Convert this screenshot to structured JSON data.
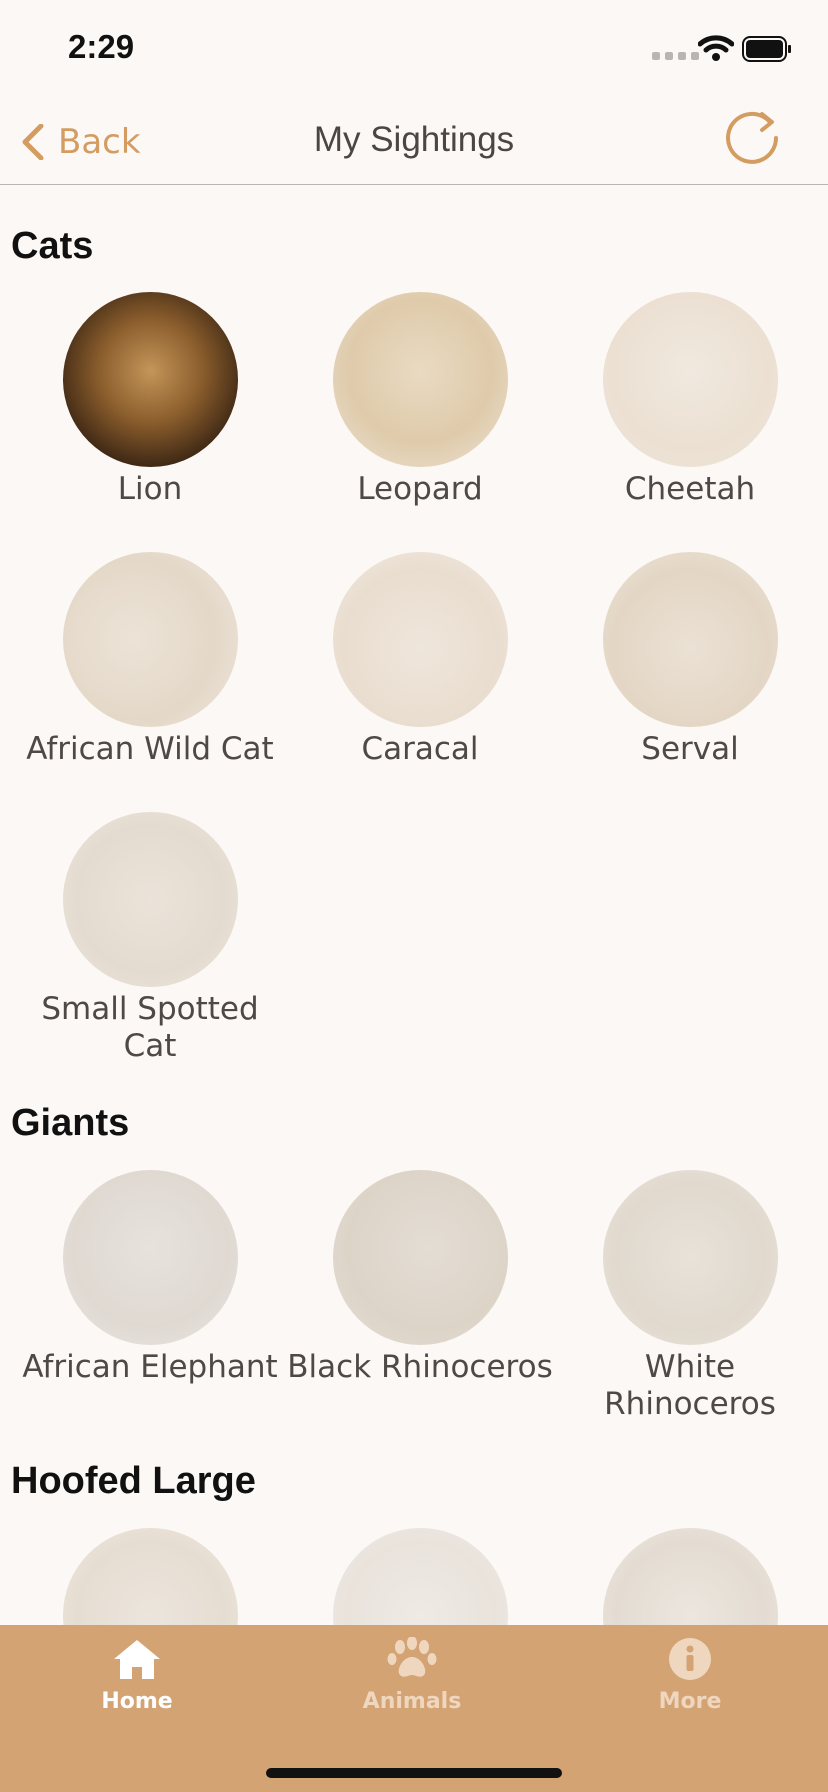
{
  "status_bar": {
    "time": "2:29"
  },
  "nav": {
    "back_label": "Back",
    "title": "My Sightings"
  },
  "sections": [
    {
      "title": "Cats",
      "animals": [
        "Lion",
        "Leopard",
        "Cheetah",
        "African Wild Cat",
        "Caracal",
        "Serval",
        "Small Spotted Cat"
      ]
    },
    {
      "title": "Giants",
      "animals": [
        "African Elephant",
        "Black Rhinoceros",
        "White Rhinoceros"
      ]
    },
    {
      "title": "Hoofed Large",
      "animals": [
        "",
        "",
        ""
      ]
    }
  ],
  "tabbar": {
    "home_label": "Home",
    "animals_label": "Animals",
    "more_label": "More"
  },
  "colors": {
    "accent": "#d39d62",
    "tabbar": "#d4a373",
    "background": "#fcf8f5"
  },
  "icons": [
    "chevron-left-icon",
    "refresh-icon",
    "home-icon",
    "paw-icon",
    "info-icon"
  ]
}
